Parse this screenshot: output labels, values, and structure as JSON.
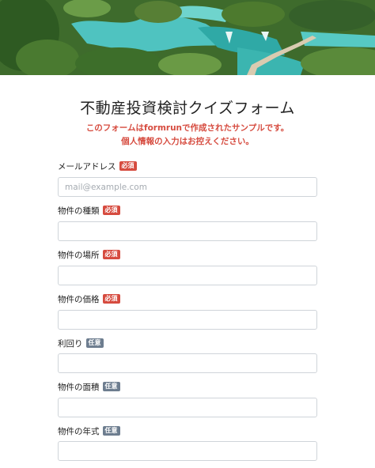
{
  "form": {
    "title": "不動産投資検討クイズフォーム",
    "note_line1": "このフォームはformrunで作成されたサンプルです。",
    "note_line2": "個人情報の入力はお控えください。"
  },
  "badges": {
    "required": "必須",
    "optional": "任意"
  },
  "fields": [
    {
      "label": "メールアドレス",
      "badge": "必須",
      "placeholder": "mail@example.com",
      "value": ""
    },
    {
      "label": "物件の種類",
      "badge": "必須",
      "placeholder": "",
      "value": ""
    },
    {
      "label": "物件の場所",
      "badge": "必須",
      "placeholder": "",
      "value": ""
    },
    {
      "label": "物件の価格",
      "badge": "必須",
      "placeholder": "",
      "value": ""
    },
    {
      "label": "利回り",
      "badge": "任意",
      "placeholder": "",
      "value": ""
    },
    {
      "label": "物件の面積",
      "badge": "任意",
      "placeholder": "",
      "value": ""
    },
    {
      "label": "物件の年式",
      "badge": "任意",
      "placeholder": "",
      "value": ""
    }
  ],
  "colors": {
    "required": "#d64b3f",
    "optional": "#6d7d8f",
    "note": "#d64b3f"
  }
}
